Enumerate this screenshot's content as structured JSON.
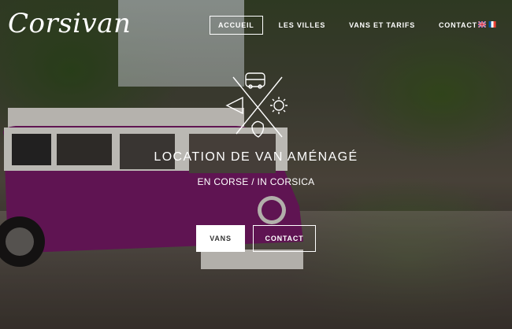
{
  "brand": {
    "logo_text": "Corsivan"
  },
  "nav": {
    "items": [
      {
        "label": "ACCUEIL",
        "active": true
      },
      {
        "label": "LES VILLES",
        "active": false
      },
      {
        "label": "VANS ET TARIFS",
        "active": false
      },
      {
        "label": "CONTACT",
        "active": false
      }
    ],
    "languages": [
      "uk-flag-icon",
      "france-flag-icon"
    ]
  },
  "hero": {
    "title": "LOCATION DE VAN AMÉNAGÉ",
    "subtitle": "EN CORSE / IN CORSICA",
    "buttons": {
      "primary": "VANS",
      "secondary": "CONTACT"
    }
  },
  "colors": {
    "van": "#7a1a6a",
    "accent_white": "#ffffff"
  }
}
